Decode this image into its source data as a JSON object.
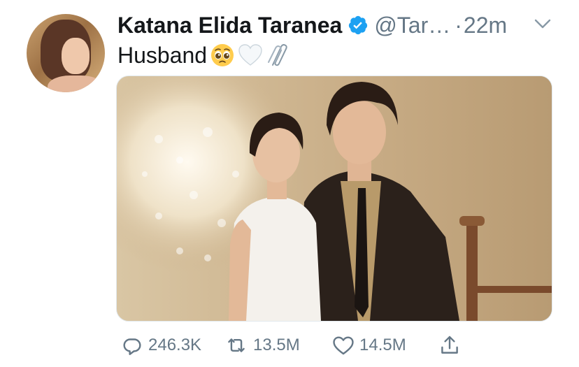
{
  "tweet": {
    "display_name": "Katana Elida Taranea",
    "handle": "@Tar…",
    "separator": "·",
    "time": "22m",
    "text": "Husband",
    "emojis": [
      "pleading-face-emoji",
      "white-heart-emoji",
      "paperclips-emoji"
    ],
    "verified": true
  },
  "actions": {
    "replies": "246.3K",
    "retweets": "13.5M",
    "likes": "14.5M"
  },
  "colors": {
    "text": "#14171a",
    "secondary": "#657786",
    "verified": "#1da1f2",
    "border": "#e1e8ed"
  }
}
